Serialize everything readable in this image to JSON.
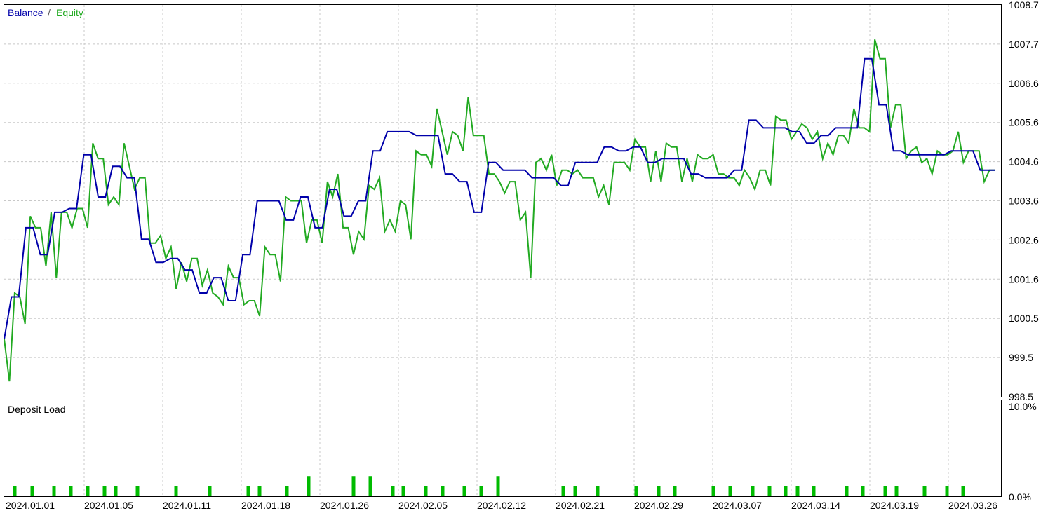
{
  "chart_data": [
    {
      "type": "line",
      "title": "",
      "legend": {
        "position": "top-left",
        "separator": "/",
        "items": [
          {
            "label": "Balance",
            "color": "#0000aa"
          },
          {
            "label": "Equity",
            "color": "#22aa22"
          }
        ]
      },
      "grid": true,
      "x_tick_labels": [
        "2024.01.01",
        "2024.01.05",
        "2024.01.11",
        "2024.01.18",
        "2024.01.26",
        "2024.02.05",
        "2024.02.12",
        "2024.02.21",
        "2024.02.29",
        "2024.03.07",
        "2024.03.14",
        "2024.03.19",
        "2024.03.26"
      ],
      "y_tick_labels": [
        "1008.7",
        "1007.7",
        "1006.6",
        "1005.6",
        "1004.6",
        "1003.6",
        "1002.6",
        "1001.6",
        "1000.5",
        "999.5",
        "998.5"
      ],
      "ylim": [
        998.5,
        1008.7
      ],
      "series": [
        {
          "name": "Balance",
          "color": "#0000aa",
          "values": [
            1000.0,
            1001.1,
            1001.1,
            1002.9,
            1002.9,
            1002.2,
            1002.2,
            1003.3,
            1003.3,
            1003.4,
            1003.4,
            1004.8,
            1004.8,
            1003.7,
            1003.7,
            1004.5,
            1004.5,
            1004.2,
            1004.2,
            1002.6,
            1002.6,
            1002.0,
            1002.0,
            1002.1,
            1002.1,
            1001.8,
            1001.8,
            1001.2,
            1001.2,
            1001.6,
            1001.6,
            1001.0,
            1001.0,
            1002.2,
            1002.2,
            1003.6,
            1003.6,
            1003.6,
            1003.6,
            1003.1,
            1003.1,
            1003.7,
            1003.7,
            1002.9,
            1002.9,
            1003.9,
            1003.9,
            1003.2,
            1003.2,
            1003.6,
            1003.6,
            1004.9,
            1004.9,
            1005.4,
            1005.4,
            1005.4,
            1005.4,
            1005.3,
            1005.3,
            1005.3,
            1005.3,
            1004.3,
            1004.3,
            1004.1,
            1004.1,
            1003.3,
            1003.3,
            1004.6,
            1004.6,
            1004.4,
            1004.4,
            1004.4,
            1004.4,
            1004.2,
            1004.2,
            1004.2,
            1004.2,
            1004.0,
            1004.0,
            1004.6,
            1004.6,
            1004.6,
            1004.6,
            1005.0,
            1005.0,
            1004.9,
            1004.9,
            1005.0,
            1005.0,
            1004.6,
            1004.6,
            1004.7,
            1004.7,
            1004.7,
            1004.7,
            1004.3,
            1004.3,
            1004.2,
            1004.2,
            1004.2,
            1004.2,
            1004.4,
            1004.4,
            1005.7,
            1005.7,
            1005.5,
            1005.5,
            1005.5,
            1005.5,
            1005.4,
            1005.4,
            1005.1,
            1005.1,
            1005.3,
            1005.3,
            1005.5,
            1005.5,
            1005.5,
            1005.5,
            1007.3,
            1007.3,
            1006.1,
            1006.1,
            1004.9,
            1004.9,
            1004.8,
            1004.8,
            1004.8,
            1004.8,
            1004.8,
            1004.8,
            1004.9,
            1004.9,
            1004.9,
            1004.9,
            1004.4,
            1004.4,
            1004.4
          ]
        },
        {
          "name": "Equity",
          "color": "#22aa22",
          "values": [
            1000.0,
            998.9,
            1001.2,
            1001.1,
            1000.4,
            1003.2,
            1002.9,
            1002.9,
            1001.9,
            1003.3,
            1001.6,
            1003.3,
            1003.3,
            1002.9,
            1003.4,
            1003.4,
            1002.9,
            1005.1,
            1004.7,
            1004.7,
            1003.5,
            1003.7,
            1003.5,
            1005.1,
            1004.5,
            1003.9,
            1004.2,
            1004.2,
            1002.5,
            1002.5,
            1002.7,
            1002.1,
            1002.4,
            1001.3,
            1002.0,
            1001.5,
            1002.1,
            1002.1,
            1001.4,
            1001.8,
            1001.2,
            1001.1,
            1000.9,
            1001.9,
            1001.6,
            1001.6,
            1000.9,
            1001.0,
            1001.0,
            1000.6,
            1002.4,
            1002.2,
            1002.2,
            1001.5,
            1003.7,
            1003.6,
            1003.6,
            1003.6,
            1002.5,
            1003.1,
            1003.1,
            1002.5,
            1004.1,
            1003.7,
            1004.3,
            1002.9,
            1002.9,
            1002.2,
            1002.8,
            1002.6,
            1004.0,
            1003.9,
            1004.2,
            1002.8,
            1003.1,
            1002.8,
            1003.6,
            1003.5,
            1002.6,
            1004.9,
            1004.8,
            1004.8,
            1004.5,
            1006.0,
            1005.4,
            1004.8,
            1005.4,
            1005.3,
            1004.9,
            1006.3,
            1005.3,
            1005.3,
            1005.3,
            1004.3,
            1004.3,
            1004.1,
            1003.8,
            1004.1,
            1004.1,
            1003.1,
            1003.3,
            1001.6,
            1004.6,
            1004.7,
            1004.4,
            1004.8,
            1004.0,
            1004.4,
            1004.4,
            1004.3,
            1004.4,
            1004.2,
            1004.2,
            1004.2,
            1003.7,
            1004.0,
            1003.5,
            1004.6,
            1004.6,
            1004.6,
            1004.4,
            1005.2,
            1005.0,
            1005.0,
            1004.1,
            1004.9,
            1004.1,
            1005.1,
            1005.0,
            1005.0,
            1004.1,
            1004.7,
            1004.1,
            1004.8,
            1004.7,
            1004.7,
            1004.8,
            1004.3,
            1004.3,
            1004.2,
            1004.2,
            1004.0,
            1004.4,
            1004.2,
            1003.9,
            1004.4,
            1004.4,
            1004.0,
            1005.8,
            1005.7,
            1005.7,
            1005.2,
            1005.4,
            1005.6,
            1005.5,
            1005.2,
            1005.4,
            1004.7,
            1005.1,
            1004.8,
            1005.3,
            1005.3,
            1005.1,
            1006.0,
            1005.5,
            1005.5,
            1005.4,
            1007.8,
            1007.3,
            1007.3,
            1005.5,
            1006.1,
            1006.1,
            1004.7,
            1004.9,
            1005.0,
            1004.6,
            1004.7,
            1004.3,
            1004.9,
            1004.8,
            1004.8,
            1004.9,
            1005.4,
            1004.6,
            1004.9,
            1004.9,
            1004.9,
            1004.1,
            1004.4,
            1004.4
          ]
        }
      ]
    },
    {
      "type": "bar",
      "title": "Deposit Load",
      "grid": true,
      "x_tick_labels": [
        "2024.01.01",
        "2024.01.05",
        "2024.01.11",
        "2024.01.18",
        "2024.01.26",
        "2024.02.05",
        "2024.02.12",
        "2024.02.21",
        "2024.02.29",
        "2024.03.07",
        "2024.03.14",
        "2024.03.19",
        "2024.03.26"
      ],
      "y_tick_labels": [
        "10.0%",
        "0.0%"
      ],
      "ylim": [
        0,
        10
      ],
      "color": "#00bb00",
      "bars": [
        {
          "index": 0,
          "value": 1.0
        },
        {
          "index": 1,
          "value": 1.0
        },
        {
          "index": 2,
          "value": 1.0
        },
        {
          "index": 3,
          "value": 1.0
        },
        {
          "index": 4,
          "value": 1.0
        },
        {
          "index": 5,
          "value": 1.0
        },
        {
          "index": 6,
          "value": 1.0
        },
        {
          "index": 7,
          "value": 1.0
        },
        {
          "index": 8,
          "value": 1.0
        },
        {
          "index": 9,
          "value": 1.0
        },
        {
          "index": 10,
          "value": 1.0
        },
        {
          "index": 11,
          "value": 1.0
        },
        {
          "index": 12,
          "value": 1.0
        },
        {
          "index": 13,
          "value": 2.0
        },
        {
          "index": 14,
          "value": 2.0
        },
        {
          "index": 15,
          "value": 2.0
        },
        {
          "index": 16,
          "value": 1.0
        },
        {
          "index": 17,
          "value": 1.0
        },
        {
          "index": 18,
          "value": 1.0
        },
        {
          "index": 19,
          "value": 1.0
        },
        {
          "index": 20,
          "value": 1.0
        },
        {
          "index": 21,
          "value": 1.0
        },
        {
          "index": 22,
          "value": 2.0
        },
        {
          "index": 23,
          "value": 1.0
        },
        {
          "index": 24,
          "value": 1.0
        },
        {
          "index": 25,
          "value": 1.0
        },
        {
          "index": 26,
          "value": 1.0
        },
        {
          "index": 27,
          "value": 1.0
        },
        {
          "index": 28,
          "value": 1.0
        },
        {
          "index": 29,
          "value": 1.0
        },
        {
          "index": 30,
          "value": 1.0
        },
        {
          "index": 31,
          "value": 1.0
        },
        {
          "index": 32,
          "value": 1.0
        },
        {
          "index": 33,
          "value": 1.0
        },
        {
          "index": 34,
          "value": 1.0
        },
        {
          "index": 35,
          "value": 1.0
        },
        {
          "index": 36,
          "value": 1.0
        },
        {
          "index": 37,
          "value": 1.0
        },
        {
          "index": 38,
          "value": 1.0
        },
        {
          "index": 39,
          "value": 1.0
        },
        {
          "index": 40,
          "value": 1.0
        },
        {
          "index": 41,
          "value": 1.0
        },
        {
          "index": 42,
          "value": 1.0
        }
      ]
    }
  ]
}
